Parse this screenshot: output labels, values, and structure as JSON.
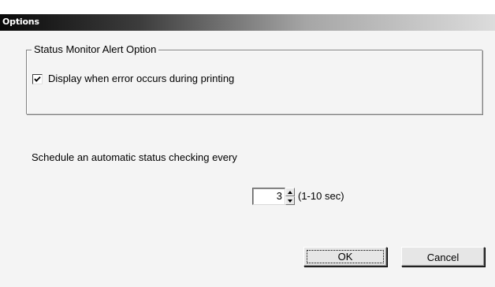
{
  "window": {
    "title": "Options"
  },
  "alert_group": {
    "legend": "Status Monitor Alert Option",
    "checkbox_label": "Display when error occurs during printing",
    "checkbox_checked": true
  },
  "schedule": {
    "label": "Schedule an automatic status checking every",
    "value": "3",
    "range_label": "(1-10 sec)"
  },
  "buttons": {
    "ok_label": "OK",
    "cancel_label": "Cancel"
  }
}
